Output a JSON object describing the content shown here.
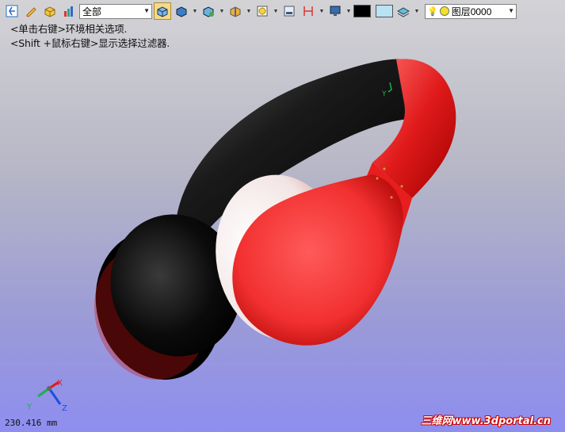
{
  "toolbar": {
    "filter_select": "全部",
    "layer_select": "图层0000"
  },
  "hints": {
    "line1": "<单击右键>环境相关选项.",
    "line2": "<Shift +鼠标右键>显示选择过滤器."
  },
  "axes": {
    "x": "X",
    "y": "Y",
    "z": "Z",
    "model_y": "Y"
  },
  "status": {
    "measurement": "230.416 mm"
  },
  "watermark": "三维网www.3dportal.cn",
  "colors": {
    "accent_red": "#e0151b",
    "headband_black": "#111111",
    "background_blue": "#9090ee"
  }
}
